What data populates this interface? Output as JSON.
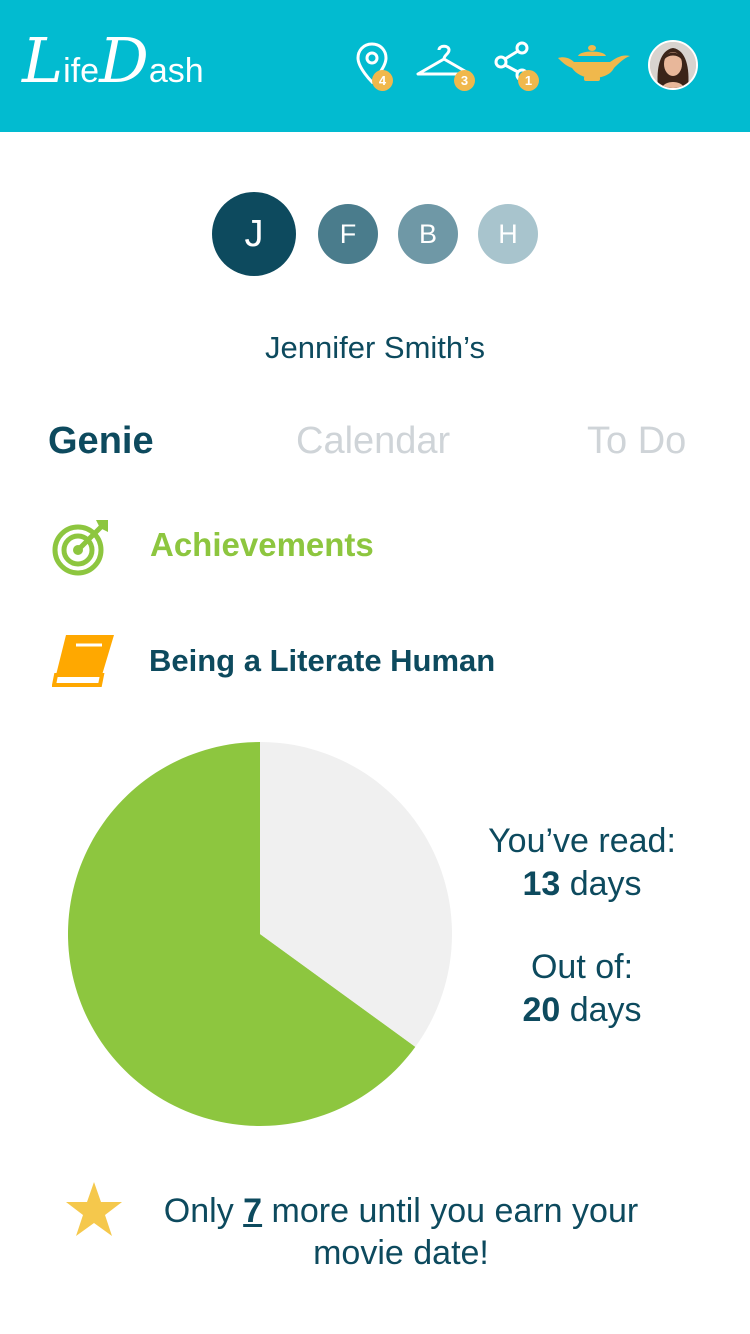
{
  "app": {
    "logo_letter_1": "L",
    "logo_rest_1": "ife",
    "logo_letter_2": "D",
    "logo_rest_2": "ash",
    "header_color": "#02bbd0"
  },
  "header_icons": [
    {
      "name": "location-pin-icon",
      "badge": "4"
    },
    {
      "name": "hanger-icon",
      "badge": "3"
    },
    {
      "name": "share-icon",
      "badge": "1"
    },
    {
      "name": "genie-lamp-icon"
    },
    {
      "name": "profile-avatar"
    }
  ],
  "family": {
    "members": [
      {
        "initial": "J",
        "active": true,
        "color": "#0d4a5e"
      },
      {
        "initial": "F",
        "active": false,
        "color": "#4a7c8c"
      },
      {
        "initial": "B",
        "active": false,
        "color": "#6f98a6"
      },
      {
        "initial": "H",
        "active": false,
        "color": "#a8c4cd"
      }
    ],
    "owner_label": "Jennifer Smith’s"
  },
  "tabs": [
    {
      "label": "Genie",
      "active": true
    },
    {
      "label": "Calendar",
      "active": false
    },
    {
      "label": "To Do",
      "active": false
    }
  ],
  "sections": {
    "achievements": {
      "label": "Achievements",
      "icon": "target-icon",
      "color": "#8dc63f"
    },
    "goal": {
      "label": "Being a Literate Human",
      "icon": "book-icon",
      "color": "#ffa800"
    }
  },
  "chart_data": {
    "type": "pie",
    "values": [
      13,
      7
    ],
    "colors": [
      "#8dc63f",
      "#f0f0f0"
    ]
  },
  "progress": {
    "read_label": "You’ve read:",
    "read_value": "13",
    "read_unit": "days",
    "total_label": "Out of:",
    "total_value": "20",
    "total_unit": "days"
  },
  "reward": {
    "prefix": "Only",
    "remaining": "7",
    "suffix": "more until you earn your movie date!",
    "icon": "star-icon"
  }
}
